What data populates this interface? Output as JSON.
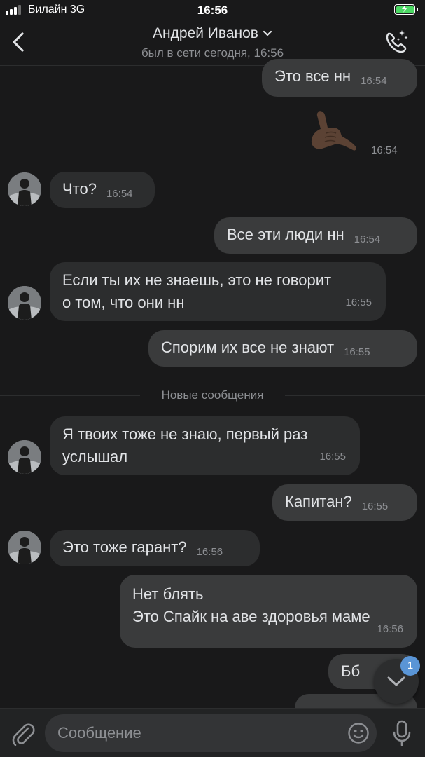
{
  "status_bar": {
    "carrier": "Билайн 3G",
    "time": "16:56",
    "battery_color": "#4cd964"
  },
  "header": {
    "name": "Андрей Иванов",
    "status": "был в сети сегодня, 16:56",
    "back_icon": "chevron-left-icon",
    "call_icon": "phone-call-icon"
  },
  "messages": [
    {
      "dir": "out",
      "text": "Это все нн",
      "time": "16:54"
    },
    {
      "dir": "out",
      "sticker": "call-me-hand-emoji",
      "time": "16:54"
    },
    {
      "dir": "in",
      "text": "Что?",
      "time": "16:54"
    },
    {
      "dir": "out",
      "text": "Все эти люди нн",
      "time": "16:54"
    },
    {
      "dir": "in",
      "lines": [
        "Если ты их не знаешь, это не говорит",
        "о том, что они нн"
      ],
      "time": "16:55"
    },
    {
      "dir": "out",
      "text": "Спорим их все не знают",
      "time": "16:55"
    },
    {
      "dir": "in",
      "lines": [
        "Я твоих тоже не знаю, первый раз",
        "услышал"
      ],
      "time": "16:55"
    },
    {
      "dir": "out",
      "text": "Капитан?",
      "time": "16:55"
    },
    {
      "dir": "in",
      "text": "Это тоже гарант?",
      "time": "16:56"
    },
    {
      "dir": "out",
      "lines": [
        "Нет блять",
        "Это Спайк на аве здоровья маме"
      ],
      "time": "16:56"
    },
    {
      "dir": "out",
      "text": "Бб"
    }
  ],
  "divider": "Новые сообщения",
  "scroll_badge": "1",
  "composer": {
    "placeholder": "Сообщение"
  },
  "colors": {
    "background": "#19191a",
    "bubble_in": "#2c2d2e",
    "bubble_out": "#3a3b3c",
    "accent": "#5a95d6"
  }
}
